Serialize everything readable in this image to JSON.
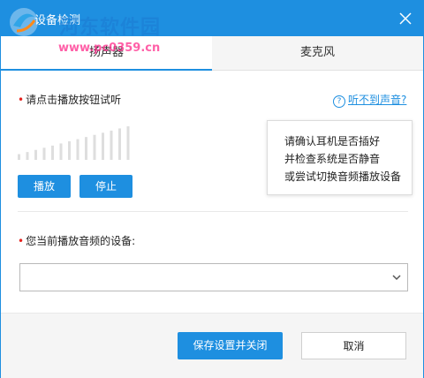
{
  "window": {
    "title": "设备检测",
    "accent_color": "#1e8fe0",
    "close_icon": "close-icon"
  },
  "watermark": {
    "top": "河东软件园",
    "bottom": "www.pc0359.cn"
  },
  "tabs": [
    {
      "label": "扬声器",
      "active": true
    },
    {
      "label": "麦克风",
      "active": false
    }
  ],
  "speaker": {
    "play_prompt": "请点击播放按钮试听",
    "help_link": "听不到声音?",
    "tooltip_lines": [
      "请确认耳机是否插好",
      "并检查系统是否静音",
      "或尝试切换音频播放设备"
    ],
    "volume_level": 0,
    "volume_bar_count": 14,
    "play_button": "播放",
    "stop_button": "停止",
    "device_label": "您当前播放音频的设备:",
    "device_value": ""
  },
  "footer": {
    "save_button": "保存设置并关闭",
    "cancel_button": "取消"
  }
}
